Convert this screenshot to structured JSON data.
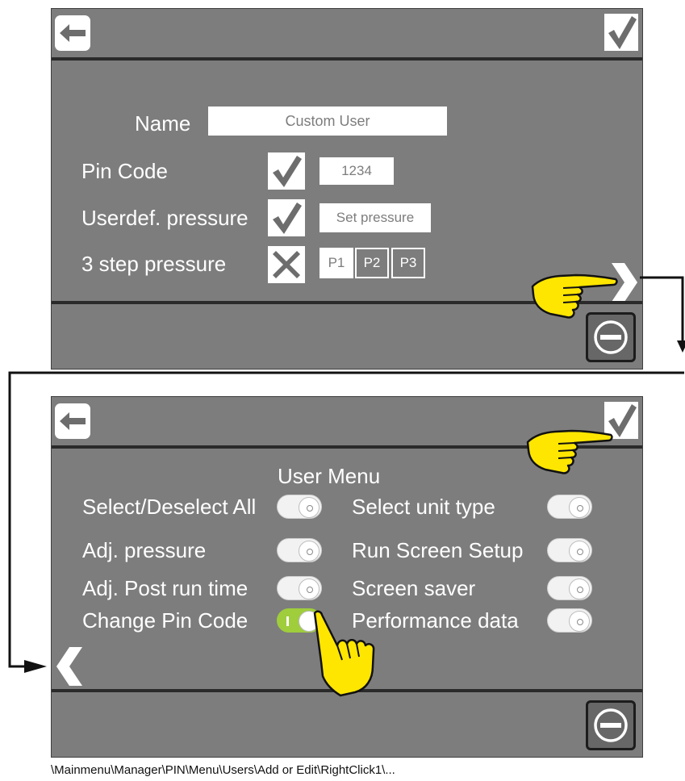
{
  "screen1": {
    "form": {
      "name_label": "Name",
      "name_value": "Custom User",
      "pin_label": "Pin Code",
      "pin_value": "1234",
      "pin_enabled": true,
      "pressure_label": "Userdef. pressure",
      "pressure_button": "Set pressure",
      "pressure_enabled": true,
      "step_label": "3 step pressure",
      "step_enabled": false,
      "steps": [
        "P1",
        "P2",
        "P3"
      ]
    }
  },
  "screen2": {
    "title": "User Menu",
    "options": [
      {
        "label": "Select/Deselect All",
        "on": false
      },
      {
        "label": "Adj. pressure",
        "on": false
      },
      {
        "label": "Adj.  Post run time",
        "on": false
      },
      {
        "label": "Change Pin Code",
        "on": true
      },
      {
        "label": "Select unit type",
        "on": false
      },
      {
        "label": "Run Screen Setup",
        "on": false
      },
      {
        "label": "Screen saver",
        "on": false
      },
      {
        "label": "Performance data",
        "on": false
      }
    ]
  },
  "caption": "\\Mainmenu\\Manager\\PIN\\Menu\\Users\\Add or Edit\\RightClick1\\...",
  "colors": {
    "screen_bg": "#7d7d7d",
    "toggle_on": "#9fcd3c",
    "hand": "#ffe600"
  },
  "icons": [
    "back-arrow-icon",
    "checkmark-icon",
    "cross-icon",
    "chevron-right-icon",
    "chevron-left-icon",
    "minus-circle-icon",
    "pointing-hand-icon"
  ]
}
